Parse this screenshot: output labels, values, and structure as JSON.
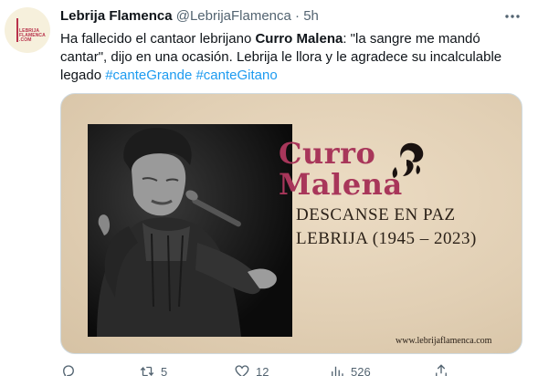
{
  "account": {
    "display_name": "Lebrija Flamenca",
    "handle": "@LebrijaFlamenca",
    "separator": "·",
    "time": "5h",
    "avatar_text": [
      "LEBRIJA",
      "FLAMENCA",
      ".COM"
    ]
  },
  "tweet": {
    "part1": "Ha fallecido el cantaor lebrijano ",
    "bold": "Curro Malena",
    "part2": ": \"la sangre me mandó cantar\", dijo en una ocasión. Lebrija le llora y le agradece su incalculable legado ",
    "hashtag1": "#canteGrande",
    "hashtag2": "#canteGitano"
  },
  "media": {
    "title_line1": "Curro",
    "title_line2": "Malena",
    "subtitle": "DESCANSE EN PAZ",
    "years": "LEBRIJA (1945 – 2023)",
    "website": "www.lebrijaflamenca.com",
    "title_color": "#a8365a"
  },
  "actions": {
    "replies": "",
    "retweets": "5",
    "likes": "12",
    "views": "526"
  },
  "icons": [
    "more-icon",
    "reply-icon",
    "retweet-icon",
    "like-icon",
    "views-icon",
    "share-icon"
  ]
}
